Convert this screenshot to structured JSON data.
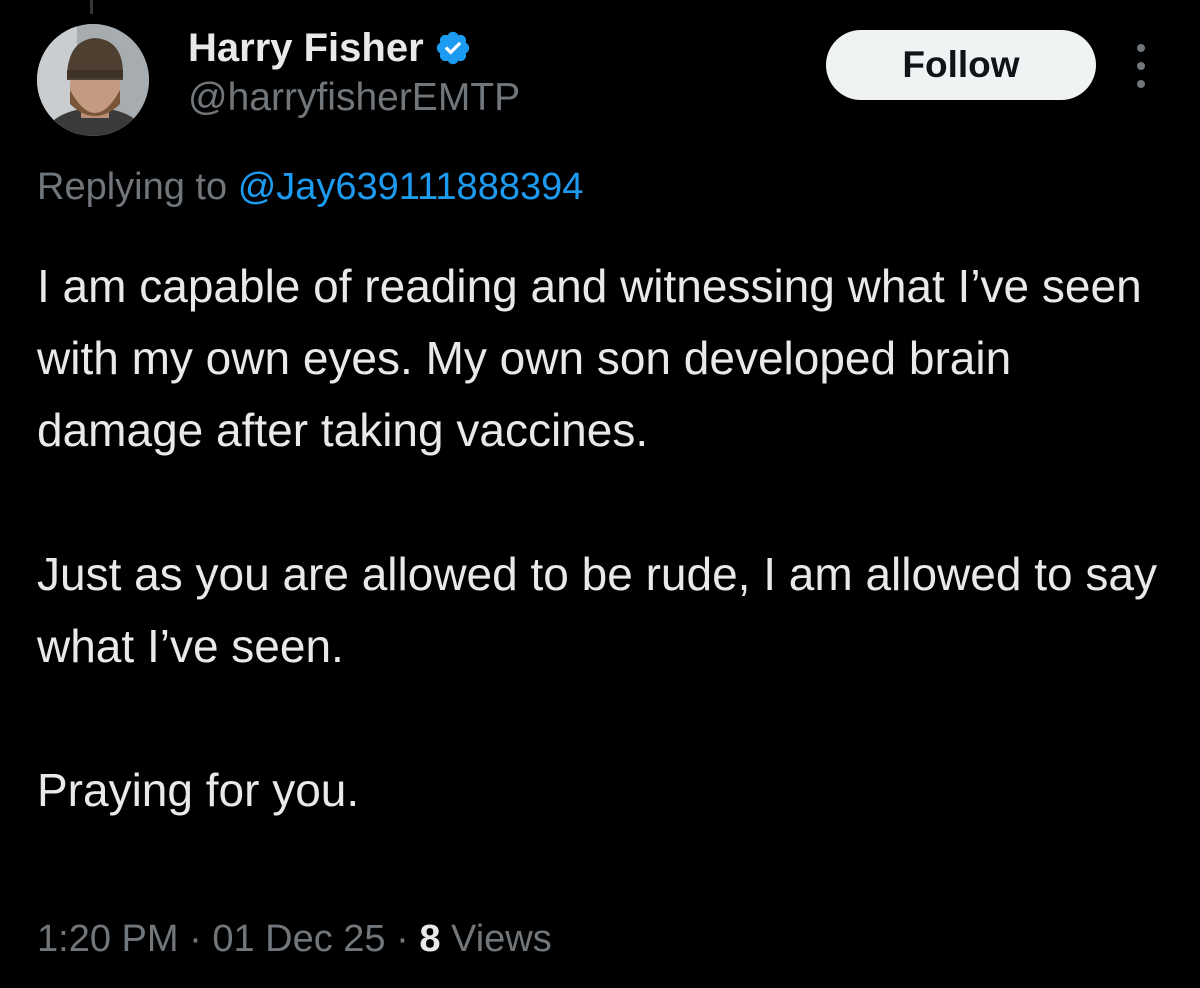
{
  "author": {
    "display_name": "Harry Fisher",
    "handle": "@harryfisherEMTP",
    "verified": true,
    "verified_color": "#1d9bf0",
    "avatar_icon": "profile-photo-bearded-man-beanie"
  },
  "follow_label": "Follow",
  "more_icon": "three-dots-vertical",
  "reply_context": {
    "prefix": "Replying to",
    "mention": "@Jay639111888394"
  },
  "tweet": {
    "paragraphs": [
      "I am capable of reading and witnessing what I’ve seen with my own eyes. My own son developed brain damage after taking vaccines.",
      "Just as you are allowed to be rude, I am allowed to say what I’ve seen.",
      "Praying for you."
    ]
  },
  "meta": {
    "time": "1:20 PM",
    "separator": "·",
    "date": "01 Dec 25",
    "views_count": "8",
    "views_label": "Views"
  },
  "colors": {
    "background": "#000000",
    "text_primary": "#e7e9ea",
    "text_secondary": "#71767b",
    "link": "#1d9bf0",
    "follow_bg": "#eff3f4"
  }
}
